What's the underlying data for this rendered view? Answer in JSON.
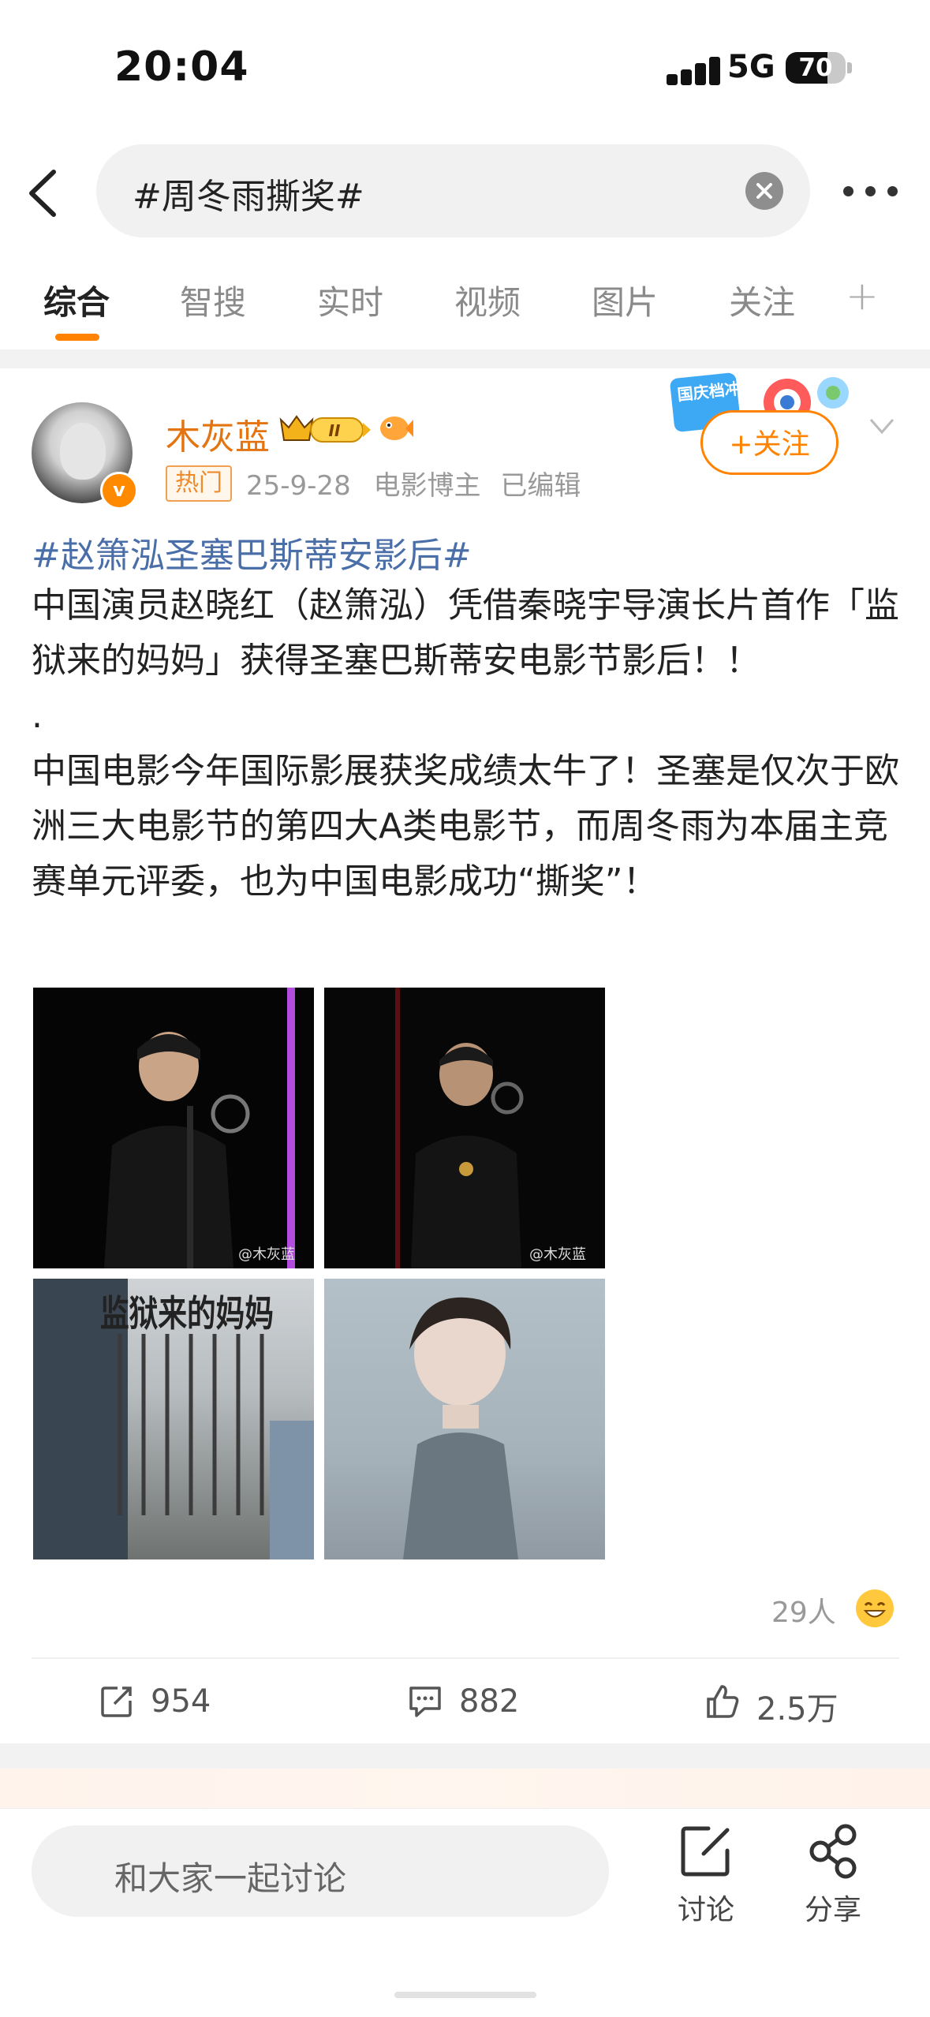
{
  "status_bar": {
    "time": "20:04",
    "network": "5G",
    "battery": "70",
    "battery_fraction": 0.7
  },
  "search": {
    "query": "#周冬雨撕奖#"
  },
  "tabs": [
    {
      "label": "综合",
      "active": true
    },
    {
      "label": "智搜"
    },
    {
      "label": "实时"
    },
    {
      "label": "视频"
    },
    {
      "label": "图片"
    },
    {
      "label": "关注"
    }
  ],
  "post": {
    "author": {
      "name": "木灰蓝",
      "vip_level": "II"
    },
    "hot_tag": "热门",
    "date": "25-9-28",
    "role": "电影博主",
    "edited": "已编辑",
    "banner_text": "国庆档冲浪",
    "follow_label": "+关注",
    "hashtag": "#赵箫泓圣塞巴斯蒂安影后#",
    "paragraphs": [
      "中国演员赵晓红（赵箫泓）凭借秦晓宇导演长片首作「监狱来的妈妈」获得圣塞巴斯蒂安电影节影后！！",
      ".",
      "中国电影今年国际影展获奖成绩太牛了！圣塞是仅次于欧洲三大电影节的第四大A类电影节，而周冬雨为本届主竞赛单元评委，也为中国电影成功“撕奖”！"
    ],
    "images": [
      {
        "watermark": "@木灰蓝"
      },
      {
        "watermark": "@木灰蓝"
      },
      {
        "watermark": ""
      },
      {
        "watermark": ""
      }
    ],
    "poster_title": "监狱来的妈妈",
    "reactions": "29人",
    "reposts": "954",
    "comments": "882",
    "likes": "2.5万"
  },
  "bottom_bar": {
    "comment_placeholder": "和大家一起讨论",
    "discuss_label": "讨论",
    "share_label": "分享"
  },
  "colors": {
    "accent": "#ff8200",
    "link": "#4a6ea8",
    "author": "#e3740f"
  }
}
